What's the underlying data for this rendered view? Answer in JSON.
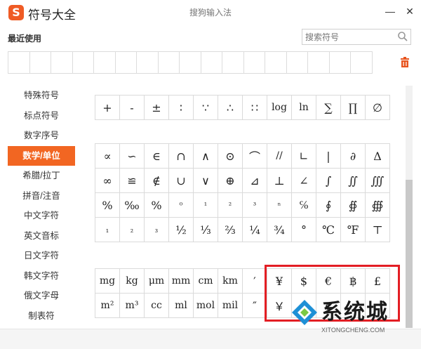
{
  "window": {
    "logo": "S",
    "title": "符号大全",
    "center_title": "搜狗输入法",
    "minimize": "—",
    "close": "✕"
  },
  "recent": {
    "label": "最近使用",
    "slots": 17
  },
  "search": {
    "placeholder": "搜索符号"
  },
  "sidebar": {
    "items": [
      {
        "label": "特殊符号",
        "active": false
      },
      {
        "label": "标点符号",
        "active": false
      },
      {
        "label": "数字序号",
        "active": false
      },
      {
        "label": "数学/单位",
        "active": true
      },
      {
        "label": "希腊/拉丁",
        "active": false
      },
      {
        "label": "拼音/注音",
        "active": false
      },
      {
        "label": "中文字符",
        "active": false
      },
      {
        "label": "英文音标",
        "active": false
      },
      {
        "label": "日文字符",
        "active": false
      },
      {
        "label": "韩文字符",
        "active": false
      },
      {
        "label": "俄文字母",
        "active": false
      },
      {
        "label": "制表符",
        "active": false
      }
    ]
  },
  "symbols": {
    "top_row": [
      "+",
      "-",
      "±",
      "∶",
      "∵",
      "∴",
      "∷",
      "log",
      "ln",
      "∑",
      "∏",
      "∅"
    ],
    "math_rows": [
      [
        "∝",
        "∽",
        "∈",
        "∩",
        "∧",
        "⊙",
        "⌒",
        "//",
        "∟",
        "|",
        "∂",
        "Δ"
      ],
      [
        "∞",
        "≌",
        "∉",
        "∪",
        "∨",
        "⊕",
        "⊿",
        "⊥",
        "∠",
        "∫",
        "∬",
        "∭"
      ],
      [
        "%",
        "‰",
        "%",
        "⁰",
        "¹",
        "²",
        "³",
        "ⁿ",
        "℅",
        "∮",
        "∯",
        "∰"
      ],
      [
        "₁",
        "₂",
        "₃",
        "½",
        "⅓",
        "⅔",
        "¼",
        "¾",
        "°",
        "℃",
        "℉",
        "⊤"
      ]
    ],
    "unit_rows": [
      [
        "mg",
        "kg",
        "μm",
        "mm",
        "cm",
        "km",
        "′",
        "¥",
        "$",
        "€",
        "฿",
        "£"
      ],
      [
        "m²",
        "m³",
        "cc",
        "ml",
        "mol",
        "mil",
        "″",
        "￥",
        "",
        "¢",
        "",
        ""
      ]
    ]
  },
  "watermark": {
    "text": "系统城",
    "url": "XITONGCHENG.COM"
  },
  "colors": {
    "accent": "#f26622",
    "highlight": "#e31e24",
    "watermark_blue": "#1e90d6"
  }
}
